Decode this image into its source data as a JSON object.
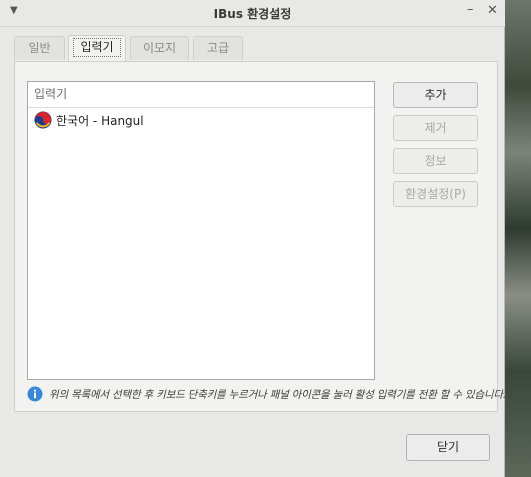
{
  "window": {
    "title": "IBus 환경설정"
  },
  "tabs": [
    {
      "label": "일반",
      "active": false
    },
    {
      "label": "입력기",
      "active": true
    },
    {
      "label": "이모지",
      "active": false
    },
    {
      "label": "고급",
      "active": false
    }
  ],
  "engine_list": {
    "header": "입력기",
    "items": [
      {
        "label": "한국어 - Hangul",
        "icon": "taegeuk-icon"
      }
    ]
  },
  "buttons": {
    "add": "추가",
    "remove": "제거",
    "about": "정보",
    "preferences": "환경설정(P)",
    "close": "닫기"
  },
  "hint": "위의 목록에서 선택한 후 키보드 단축키를 누르거나 패널 아이콘을 눌러 활성 입력기를 전환 할 수 있습니다.",
  "colors": {
    "info_icon": "#3a87d8",
    "accent_red": "#d4272e",
    "accent_blue": "#1f3e93",
    "accent_yellow": "#f2b51d"
  }
}
